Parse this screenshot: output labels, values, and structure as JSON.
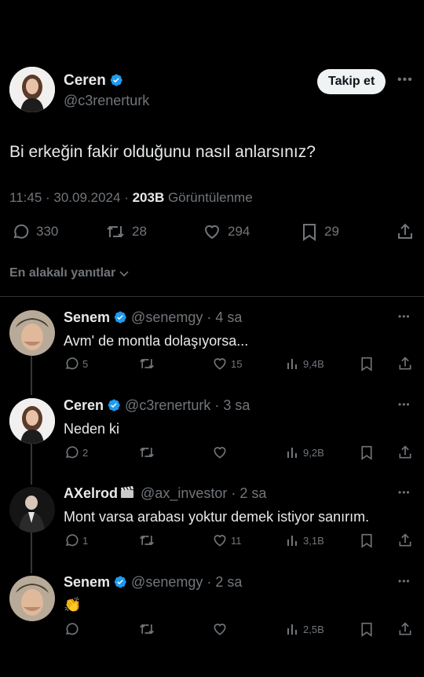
{
  "tweet": {
    "author_name": "Ceren",
    "author_handle": "@c3renerturk",
    "follow_label": "Takip et",
    "text": "Bi erkeğin fakir olduğunu nasıl anlarsınız?",
    "time": "11:45 · 30.09.2024 · ",
    "views_count": "203B",
    "views_label": " Görüntülenme",
    "stats": {
      "replies": "330",
      "retweets": "28",
      "likes": "294",
      "bookmarks": "29"
    }
  },
  "replies_sort_label": "En alakalı yanıtlar",
  "replies": [
    {
      "name": "Senem",
      "handle": "@senemgy",
      "time": "· 4 sa",
      "text": "Avm' de montla dolaşıyorsa...",
      "replies": "5",
      "retweets": "",
      "likes": "15",
      "views": "9,4B"
    },
    {
      "name": "Ceren",
      "handle": "@c3renerturk",
      "time": "· 3 sa",
      "text": "Neden ki",
      "replies": "2",
      "retweets": "",
      "likes": "",
      "views": "9,2B"
    },
    {
      "name": "AXelrod",
      "handle": "@ax_investor",
      "time": "· 2 sa",
      "text": "Mont varsa arabası yoktur demek istiyor sanırım.",
      "replies": "1",
      "retweets": "",
      "likes": "11",
      "views": "3,1B"
    },
    {
      "name": "Senem",
      "handle": "@senemgy",
      "time": "· 2 sa",
      "text": "👏",
      "replies": "",
      "retweets": "",
      "likes": "",
      "views": "2,5B"
    }
  ],
  "colors": {
    "background": "#000000",
    "text": "#e7e9ea",
    "muted": "#71767b",
    "verified": "#1d9bf0",
    "divider": "#2f3336"
  }
}
